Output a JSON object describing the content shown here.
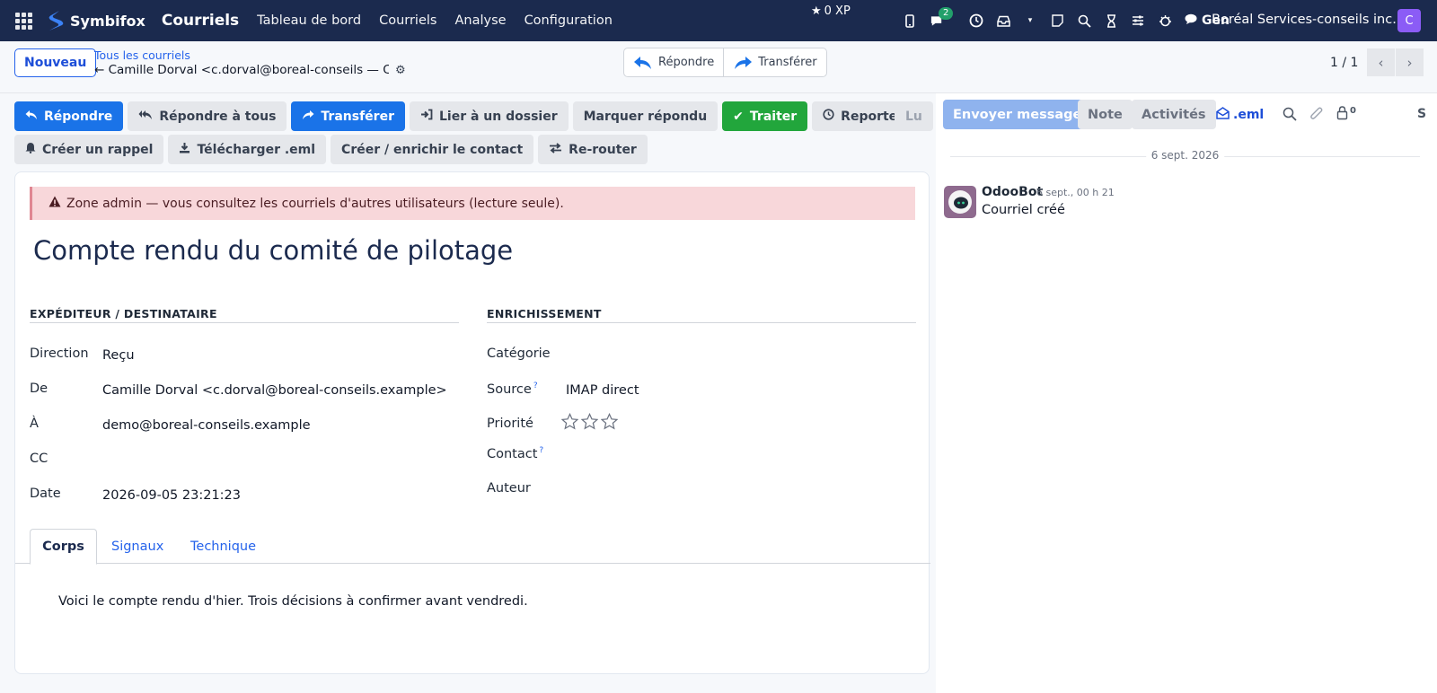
{
  "navbar": {
    "brand": "Symbifox",
    "module": "Courriels",
    "menu": [
      "Tableau de bord",
      "Courriels",
      "Analyse",
      "Configuration"
    ],
    "xp": "0 XP",
    "chat_badge": "2",
    "user_short": "Gen",
    "company": "Boréal Services-conseils inc.",
    "avatar_letter": "C"
  },
  "control_panel": {
    "new_button": "Nouveau",
    "breadcrumb_parent": "Tous les courriels",
    "breadcrumb_current": "← Camille Dorval <c.dorval@boreal-conseils — C...",
    "reply": "Répondre",
    "forward": "Transférer",
    "pager": "1 / 1"
  },
  "actions": {
    "row1": [
      "Répondre",
      "Répondre à tous",
      "Transférer",
      "Lier à un dossier",
      "Marquer répondu",
      "Traiter",
      "Reporter"
    ],
    "read": "Lu",
    "row2": [
      "Créer un rappel",
      "Télécharger .eml",
      "Créer / enrichir le contact",
      "Re-router"
    ]
  },
  "form": {
    "alert": "Zone admin — vous consultez les courriels d'autres utilisateurs (lecture seule).",
    "title": "Compte rendu du comité de pilotage",
    "section_left": "EXPÉDITEUR / DESTINATAIRE",
    "section_right": "ENRICHISSEMENT",
    "left_fields": [
      {
        "label": "Direction",
        "value": "Reçu"
      },
      {
        "label": "De",
        "value": "Camille Dorval <c.dorval@boreal-conseils.example>"
      },
      {
        "label": "À",
        "value": "demo@boreal-conseils.example"
      },
      {
        "label": "CC",
        "value": ""
      },
      {
        "label": "Date",
        "value": "2026-09-05 23:21:23"
      }
    ],
    "right_fields": [
      {
        "label": "Catégorie",
        "value": ""
      },
      {
        "label": "Source",
        "value": "IMAP direct",
        "help": "?"
      },
      {
        "label": "Priorité",
        "value": ""
      },
      {
        "label": "Contact",
        "value": "",
        "help": "?"
      },
      {
        "label": "Auteur",
        "value": ""
      }
    ],
    "priority_stars": 0,
    "tabs": [
      "Corps",
      "Signaux",
      "Technique"
    ],
    "body": "Voici le compte rendu d'hier. Trois décisions à confirmer avant vendredi."
  },
  "chatter": {
    "send": "Envoyer message",
    "note": "Note",
    "activities": "Activités",
    "eml": ".eml",
    "followers": "0",
    "follow_letter": "S",
    "date_sep": "6 sept. 2026",
    "author": "OdooBot",
    "msg_date": "6 sept., 00 h 21",
    "msg_body": "Courriel créé"
  },
  "colors": {
    "navbar": "#1b2a4e",
    "primary": "#1a73e8",
    "success": "#22a63c",
    "alert_bg": "#f8d7da"
  }
}
